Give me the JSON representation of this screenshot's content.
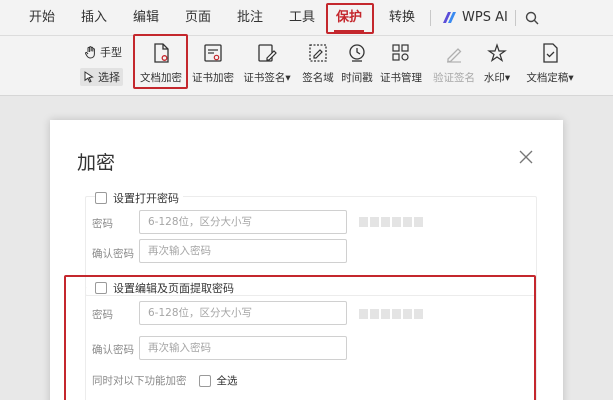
{
  "menu": {
    "items": [
      "开始",
      "插入",
      "编辑",
      "页面",
      "批注",
      "工具",
      "保护",
      "转换"
    ],
    "active": "保护",
    "ai_label": "WPS AI"
  },
  "toolbar": {
    "hand_label": "手型",
    "select_label": "选择",
    "tools": [
      "文档加密",
      "证书加密",
      "证书签名",
      "签名域",
      "时间戳",
      "证书管理",
      "验证签名",
      "水印",
      "文档定稿"
    ],
    "disabled": [
      "验证签名"
    ],
    "dropdown": [
      "证书签名",
      "水印",
      "文档定稿"
    ]
  },
  "dialog": {
    "title": "加密",
    "open_section": {
      "label": "设置打开密码",
      "password_label": "密码",
      "password_placeholder": "6-128位，区分大小写",
      "confirm_label": "确认密码",
      "confirm_placeholder": "再次输入密码"
    },
    "edit_section": {
      "label": "设置编辑及页面提取密码",
      "password_label": "密码",
      "password_placeholder": "6-128位，区分大小写",
      "confirm_label": "确认密码",
      "confirm_placeholder": "再次输入密码",
      "functions_label": "同时对以下功能加密",
      "select_all_label": "全选"
    }
  },
  "colors": {
    "accent": "#c4272d",
    "menubar_bg": "#f3f3f3",
    "canvas_bg": "#e8e8e8"
  }
}
